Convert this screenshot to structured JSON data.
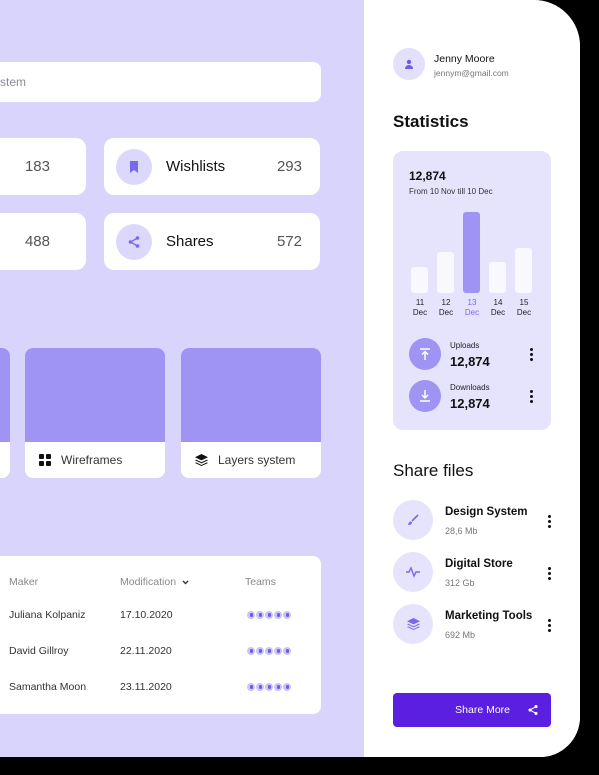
{
  "search": {
    "placeholder_fragment": "stem"
  },
  "stats": [
    {
      "label": "",
      "value": "183"
    },
    {
      "label": "Wishlists",
      "value": "293",
      "icon": "bookmark-icon"
    },
    {
      "label": "",
      "value": "488"
    },
    {
      "label": "Shares",
      "value": "572",
      "icon": "share-icon"
    }
  ],
  "tiles": [
    {
      "label": "Wireframes",
      "icon": "grid-icon"
    },
    {
      "label": "Layers system",
      "icon": "layers-icon"
    }
  ],
  "table": {
    "headers": {
      "maker": "Maker",
      "modification": "Modification",
      "teams": "Teams"
    },
    "rows": [
      {
        "maker": "Juliana Kolpaniz",
        "modification": "17.10.2020"
      },
      {
        "maker": "David Gillroy",
        "modification": "22.11.2020"
      },
      {
        "maker": "Samantha Moon",
        "modification": "23.11.2020"
      }
    ]
  },
  "user": {
    "name": "Jenny Moore",
    "email": "jennym@gmail.com"
  },
  "statistics": {
    "title": "Statistics",
    "total": "12,874",
    "range": "From 10 Nov till 10 Dec",
    "bars": [
      {
        "day": "11",
        "month": "Dec",
        "value": 0.32,
        "active": false
      },
      {
        "day": "12",
        "month": "Dec",
        "value": 0.5,
        "active": false
      },
      {
        "day": "13",
        "month": "Dec",
        "value": 1.0,
        "active": true
      },
      {
        "day": "14",
        "month": "Dec",
        "value": 0.38,
        "active": false
      },
      {
        "day": "15",
        "month": "Dec",
        "value": 0.56,
        "active": false
      }
    ],
    "uploads": {
      "label": "Uploads",
      "value": "12,874"
    },
    "downloads": {
      "label": "Downloads",
      "value": "12,874"
    }
  },
  "share": {
    "title": "Share files",
    "files": [
      {
        "name": "Design System",
        "size": "28,6 Mb",
        "icon": "brush-icon"
      },
      {
        "name": "Digital Store",
        "size": "312 Gb",
        "icon": "pulse-icon"
      },
      {
        "name": "Marketing Tools",
        "size": "692 Mb",
        "icon": "layers-icon"
      }
    ],
    "button": "Share More"
  },
  "colors": {
    "accent": "#9f93f4",
    "primary": "#5a1fe0",
    "background": "#d8d4fb"
  }
}
